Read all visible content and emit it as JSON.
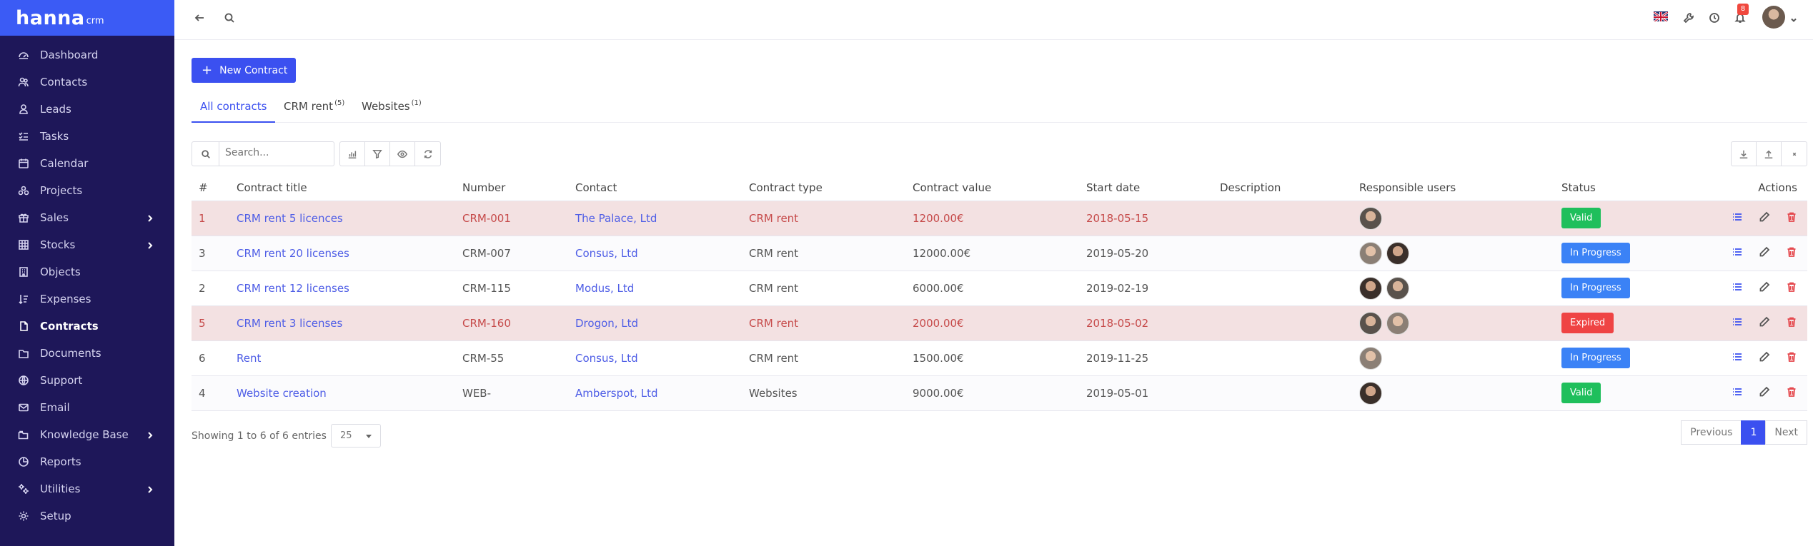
{
  "brand": {
    "name": "hanna",
    "suffix": "crm"
  },
  "sidebar": {
    "items": [
      {
        "label": "Dashboard",
        "icon": "dashboard-icon",
        "submenu": false,
        "active": false
      },
      {
        "label": "Contacts",
        "icon": "contacts-icon",
        "submenu": false,
        "active": false
      },
      {
        "label": "Leads",
        "icon": "leads-icon",
        "submenu": false,
        "active": false
      },
      {
        "label": "Tasks",
        "icon": "tasks-icon",
        "submenu": false,
        "active": false
      },
      {
        "label": "Calendar",
        "icon": "calendar-icon",
        "submenu": false,
        "active": false
      },
      {
        "label": "Projects",
        "icon": "projects-icon",
        "submenu": false,
        "active": false
      },
      {
        "label": "Sales",
        "icon": "sales-icon",
        "submenu": true,
        "active": false
      },
      {
        "label": "Stocks",
        "icon": "stocks-icon",
        "submenu": true,
        "active": false
      },
      {
        "label": "Objects",
        "icon": "objects-icon",
        "submenu": false,
        "active": false
      },
      {
        "label": "Expenses",
        "icon": "expenses-icon",
        "submenu": false,
        "active": false
      },
      {
        "label": "Contracts",
        "icon": "contracts-icon",
        "submenu": false,
        "active": true
      },
      {
        "label": "Documents",
        "icon": "documents-icon",
        "submenu": false,
        "active": false
      },
      {
        "label": "Support",
        "icon": "support-icon",
        "submenu": false,
        "active": false
      },
      {
        "label": "Email",
        "icon": "email-icon",
        "submenu": false,
        "active": false
      },
      {
        "label": "Knowledge Base",
        "icon": "knowledge-base-icon",
        "submenu": true,
        "active": false
      },
      {
        "label": "Reports",
        "icon": "reports-icon",
        "submenu": false,
        "active": false
      },
      {
        "label": "Utilities",
        "icon": "utilities-icon",
        "submenu": true,
        "active": false
      },
      {
        "label": "Setup",
        "icon": "setup-icon",
        "submenu": false,
        "active": false
      }
    ]
  },
  "topbar": {
    "notifications_count": "8"
  },
  "actions": {
    "new_contract": "New Contract"
  },
  "tabs": [
    {
      "label": "All contracts",
      "count": "",
      "active": true
    },
    {
      "label": "CRM rent",
      "count": "(5)",
      "active": false
    },
    {
      "label": "Websites",
      "count": "(1)",
      "active": false
    }
  ],
  "search": {
    "placeholder": "Search..."
  },
  "table": {
    "columns": [
      "#",
      "Contract title",
      "Number",
      "Contact",
      "Contract type",
      "Contract value",
      "Start date",
      "Description",
      "Responsible users",
      "Status",
      "Actions"
    ],
    "rows": [
      {
        "id": "1",
        "title": "CRM rent 5 licences",
        "number": "CRM-001",
        "contact": "The Palace, Ltd",
        "type": "CRM rent",
        "value": "1200.00€",
        "start": "2018-05-15",
        "description": "",
        "users": 1,
        "status": "Valid",
        "expired": true
      },
      {
        "id": "3",
        "title": "CRM rent 20 licenses",
        "number": "CRM-007",
        "contact": "Consus, Ltd",
        "type": "CRM rent",
        "value": "12000.00€",
        "start": "2019-05-20",
        "description": "",
        "users": 2,
        "status": "In Progress",
        "expired": false
      },
      {
        "id": "2",
        "title": "CRM rent 12 licenses",
        "number": "CRM-115",
        "contact": "Modus, Ltd",
        "type": "CRM rent",
        "value": "6000.00€",
        "start": "2019-02-19",
        "description": "",
        "users": 2,
        "status": "In Progress",
        "expired": false
      },
      {
        "id": "5",
        "title": "CRM rent 3 licenses",
        "number": "CRM-160",
        "contact": "Drogon, Ltd",
        "type": "CRM rent",
        "value": "2000.00€",
        "start": "2018-05-02",
        "description": "",
        "users": 2,
        "status": "Expired",
        "expired": true
      },
      {
        "id": "6",
        "title": "Rent",
        "number": "CRM-55",
        "contact": "Consus, Ltd",
        "type": "CRM rent",
        "value": "1500.00€",
        "start": "2019-11-25",
        "description": "",
        "users": 1,
        "status": "In Progress",
        "expired": false
      },
      {
        "id": "4",
        "title": "Website creation",
        "number": "WEB-",
        "contact": "Amberspot, Ltd",
        "type": "Websites",
        "value": "9000.00€",
        "start": "2019-05-01",
        "description": "",
        "users": 1,
        "status": "Valid",
        "expired": false
      }
    ]
  },
  "status_colors": {
    "Valid": "#1fbf5c",
    "In Progress": "#3b82f6",
    "Expired": "#ef4444"
  },
  "footer": {
    "showing": "Showing 1 to 6 of 6 entries",
    "page_size": "25"
  },
  "pagination": {
    "previous": "Previous",
    "current": "1",
    "next": "Next"
  }
}
